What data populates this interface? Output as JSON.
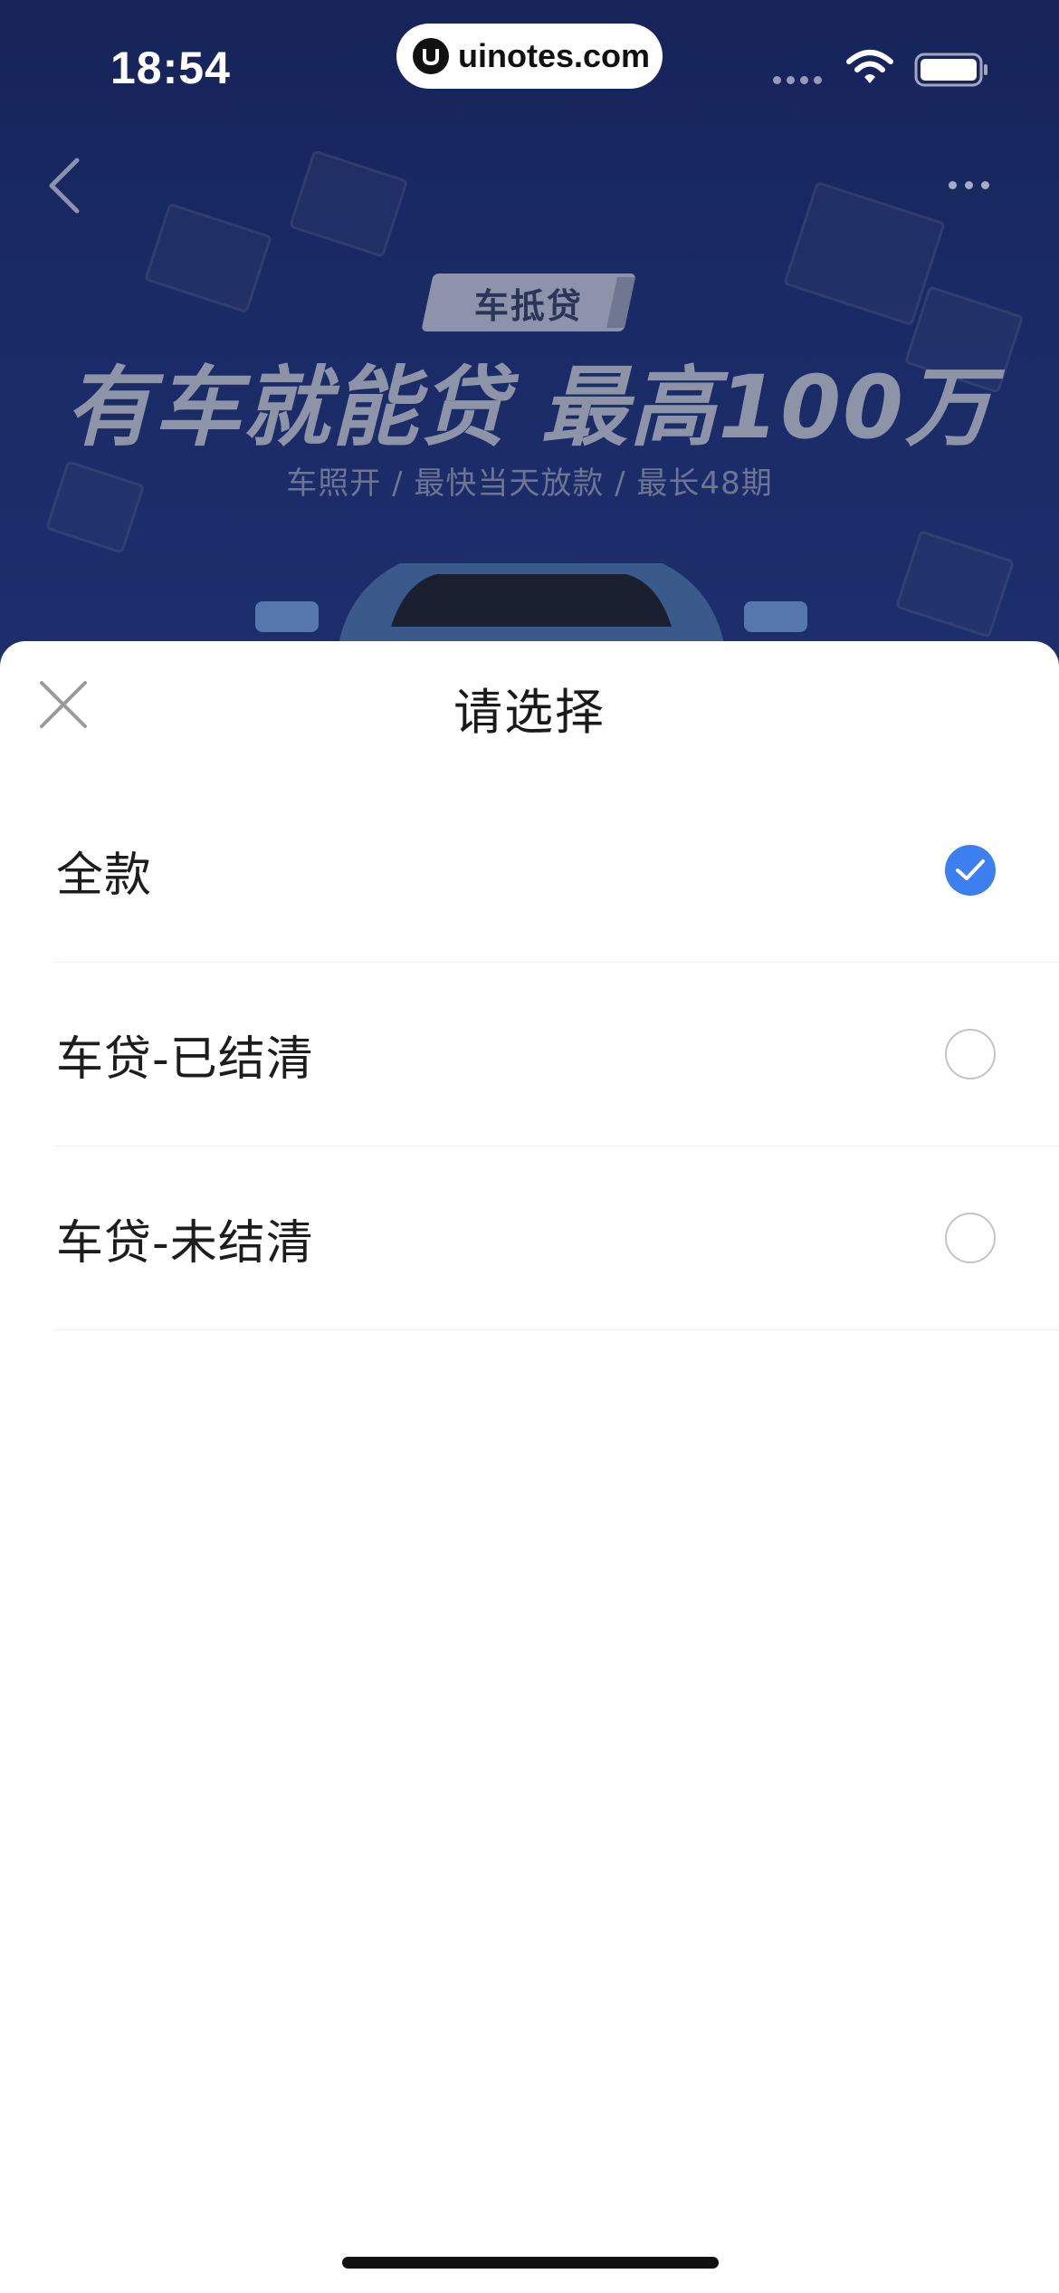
{
  "status_bar": {
    "time": "18:54",
    "watermark": "uinotes.com"
  },
  "hero": {
    "badge": "车抵贷",
    "title": "有车就能贷 最高100万",
    "subtitle": "车照开 / 最快当天放款 / 最长48期"
  },
  "sheet": {
    "title": "请选择",
    "options": [
      {
        "label": "全款",
        "selected": true
      },
      {
        "label": "车贷-已结清",
        "selected": false
      },
      {
        "label": "车贷-未结清",
        "selected": false
      }
    ]
  },
  "colors": {
    "accent": "#3b7ff0",
    "hero_background": "#2a44a3"
  },
  "icons": {
    "back": "chevron-left-icon",
    "more": "more-dots-icon",
    "close": "close-icon",
    "check": "check-icon",
    "wifi": "wifi-icon",
    "battery": "battery-icon"
  }
}
